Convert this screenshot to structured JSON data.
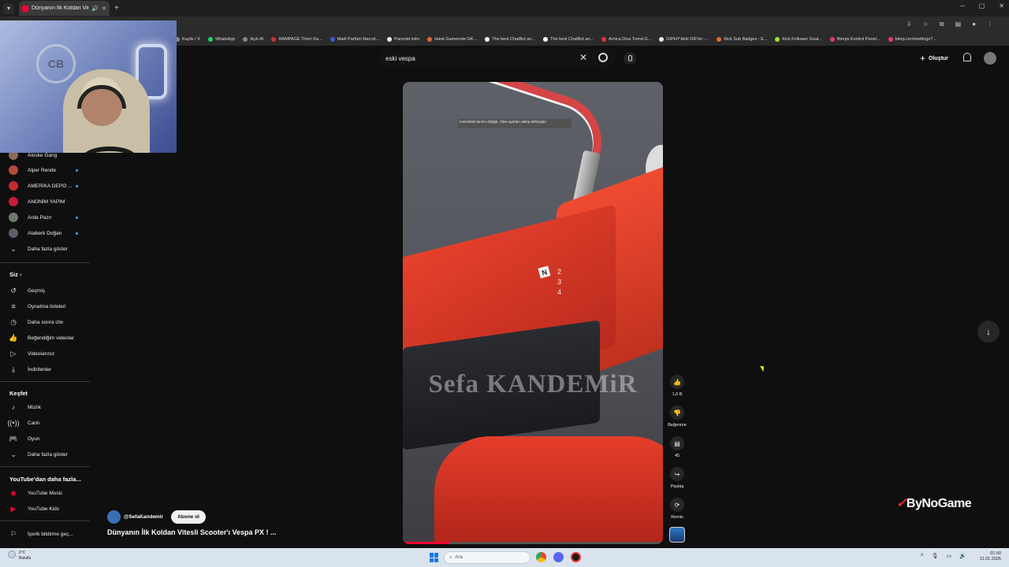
{
  "browser": {
    "tab_title": "Dünyanın İlk Koldan Vitesli",
    "bookmarks": [
      "Kaylis / X",
      "WhatsApp",
      "Açık AI",
      "RAMPAGE Triom Ka...",
      "Madi Parfüm Narcot...",
      "Panzoid intro",
      "Havit Gamenote GK...",
      "The best ChatBot an...",
      "The best ChatBot an...",
      "Arnica Diva Trend G...",
      "GIPHY'deki GIF'ler -...",
      "Kick Sub Badges - E...",
      "Kick Follower Goal...",
      "Bierps Kontrol Panel...",
      "blerp.com/settings?..."
    ]
  },
  "youtube": {
    "search_query": "eski vespa",
    "create_label": "Oluştur"
  },
  "sidebar": {
    "subscriptions": [
      {
        "label": "Aloske Gang",
        "dot": false,
        "color": "#8a6a55"
      },
      {
        "label": "Alper Rende",
        "dot": true,
        "color": "#b34a3a"
      },
      {
        "label": "AMERİKA DEPO ...",
        "dot": true,
        "color": "#c42b2b"
      },
      {
        "label": "ANONİM YAPIM",
        "dot": false,
        "color": "#c31b3b"
      },
      {
        "label": "Arda Pazır",
        "dot": true,
        "color": "#6d7a6a"
      },
      {
        "label": "Ataberk Doğan",
        "dot": true,
        "color": "#5a5f6a"
      }
    ],
    "show_more_1": "Daha fazla göster",
    "you_header": "Siz",
    "you_items": [
      "Geçmiş",
      "Oynatma listeleri",
      "Daha sonra izle",
      "Beğendiğim videolar",
      "Videolarınız",
      "İndirilenler"
    ],
    "explore_header": "Keşfet",
    "explore_items": [
      "Müzik",
      "Canlı",
      "Oyun"
    ],
    "show_more_2": "Daha fazla göster",
    "more_header": "YouTube'dan daha fazla...",
    "more_items": [
      "YouTube Music",
      "YouTube Kids"
    ],
    "report_label": "İçerik bildirme geç..."
  },
  "video": {
    "caption_text": "motosiklet tanımı değişti. Vites ayarları aktep debriyajla",
    "watermark": "Sefa KANDEMiR",
    "gear_label": "N",
    "gear_digits": "2 3 4",
    "progress": 0.18
  },
  "actions": {
    "likes": "1,6 B",
    "dislike_label": "Beğenme",
    "comments": "45",
    "share_label": "Paylaş",
    "remix_label": "Remix"
  },
  "channel": {
    "handle": "@SefaKandemir",
    "subscribe_label": "Abone ol",
    "video_title": "Dünyanın İlk Koldan Vitesli Scooter'ı Vespa PX ! ..."
  },
  "overlay": {
    "brand": "ByNoGame",
    "webcam_logo": "CB"
  },
  "taskbar": {
    "temp": "6°C",
    "weather": "Bulutlu",
    "search_placeholder": "Ara",
    "time": "01:50",
    "date": "11.01.2026"
  }
}
